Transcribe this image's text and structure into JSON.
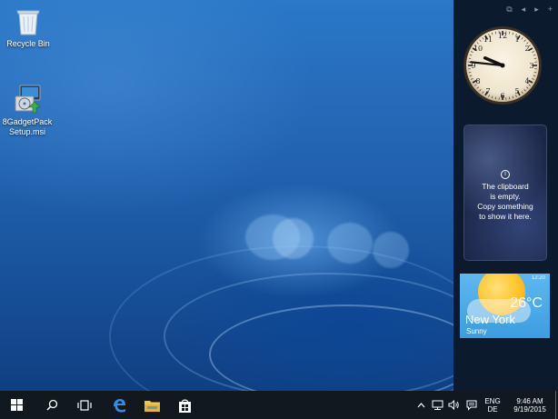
{
  "desktop": {
    "icons": [
      {
        "label": "Recycle Bin",
        "icon": "recycle-bin-icon"
      },
      {
        "label": "8GadgetPackSetup.msi",
        "icon": "installer-icon"
      }
    ]
  },
  "sidebar": {
    "controls": [
      "copy-icon",
      "prev-icon",
      "next-icon",
      "add-icon"
    ],
    "clock": {
      "hour": 9,
      "minute": 46
    },
    "clipboard": {
      "line1": "The clipboard",
      "line2": "is empty.",
      "line3": "Copy something",
      "line4": "to show it here."
    },
    "weather": {
      "city": "New York",
      "temp": "26°C",
      "condition": "Sunny",
      "time": "12:20"
    }
  },
  "taskbar": {
    "buttons": [
      "start-icon",
      "search-icon",
      "task-view-icon",
      "edge-icon",
      "file-explorer-icon",
      "store-icon"
    ],
    "tray": {
      "lang_top": "ENG",
      "lang_bottom": "DE",
      "time": "9:46 AM",
      "date": "9/19/2015"
    }
  },
  "colors": {
    "taskbar": "#111820",
    "sidebar": "#0a1423",
    "accent": "#1f5fa6"
  }
}
